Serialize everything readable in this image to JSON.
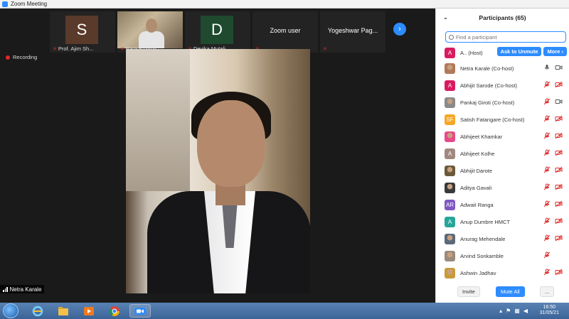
{
  "window": {
    "title": "Zoom Meeting"
  },
  "video_strip": {
    "tiles": [
      {
        "name": "Prof. Ajim Sh...",
        "initial": "S",
        "color": "#5a3a2a"
      },
      {
        "name": "Pankaj Giroti"
      },
      {
        "name": "Devika Mutali...",
        "initial": "D",
        "color": "#1f4a2e"
      },
      {
        "name": "Zoom user"
      },
      {
        "name": "Yogeshwar Pag..."
      }
    ]
  },
  "recording": {
    "label": "Recording"
  },
  "active_speaker": {
    "name": "Netra Karale"
  },
  "participants": {
    "title": "Participants (65)",
    "search_placeholder": "Find a participant",
    "host": {
      "name": "A.. (Host)",
      "initial": "A",
      "color": "#d81b60",
      "ask_unmute": "Ask to Unmute",
      "more": "More"
    },
    "list": [
      {
        "name": "Netra Karale (Co-host)",
        "initial": "",
        "color": "#b07a5a",
        "photo": true,
        "mic": "on",
        "cam": "on"
      },
      {
        "name": "Abhijit Sarode (Co-host)",
        "initial": "A",
        "color": "#d81b60",
        "mic": "muted",
        "cam": "off"
      },
      {
        "name": "Pankaj Giroti (Co-host)",
        "initial": "",
        "color": "#8a8a8a",
        "photo": true,
        "mic": "muted",
        "cam": "on"
      },
      {
        "name": "Satish Fatangare (Co-host)",
        "initial": "SF",
        "color": "#f5a623",
        "mic": "muted",
        "cam": "off"
      },
      {
        "name": "Abhijeet Khamkar",
        "initial": "",
        "color": "#e84a8a",
        "photo": true,
        "mic": "muted",
        "cam": "off"
      },
      {
        "name": "Abhijeet Kolhe",
        "initial": "A",
        "color": "#a1887f",
        "mic": "muted",
        "cam": "off"
      },
      {
        "name": "Abhijit Darote",
        "initial": "",
        "color": "#6a5a3a",
        "photo": true,
        "mic": "muted",
        "cam": "off"
      },
      {
        "name": "Aditya Gavali",
        "initial": "",
        "color": "#3a3a3a",
        "photo": true,
        "mic": "muted",
        "cam": "off"
      },
      {
        "name": "Adwait Ranga",
        "initial": "AR",
        "color": "#7e57c2",
        "mic": "muted",
        "cam": "off"
      },
      {
        "name": "Anup Dumbre HMCT",
        "initial": "A",
        "color": "#26a69a",
        "mic": "muted",
        "cam": "off"
      },
      {
        "name": "Anurag Mehendale",
        "initial": "",
        "color": "#5a6a7a",
        "photo": true,
        "mic": "muted",
        "cam": "off"
      },
      {
        "name": "Arvind Sonkamble",
        "initial": "",
        "color": "#9a8a7a",
        "photo": true,
        "mic": "muted",
        "cam": "none"
      },
      {
        "name": "Ashwin Jadhav",
        "initial": "",
        "color": "#c89a3a",
        "photo": true,
        "mic": "muted",
        "cam": "off"
      }
    ],
    "footer": {
      "invite": "Invite",
      "mute_all": "Mute All",
      "more": "..."
    }
  },
  "taskbar": {
    "time": "16:50",
    "date": "31/05/21",
    "apps": [
      "windows-start",
      "internet-explorer",
      "file-explorer",
      "media-player",
      "chrome",
      "zoom"
    ]
  }
}
